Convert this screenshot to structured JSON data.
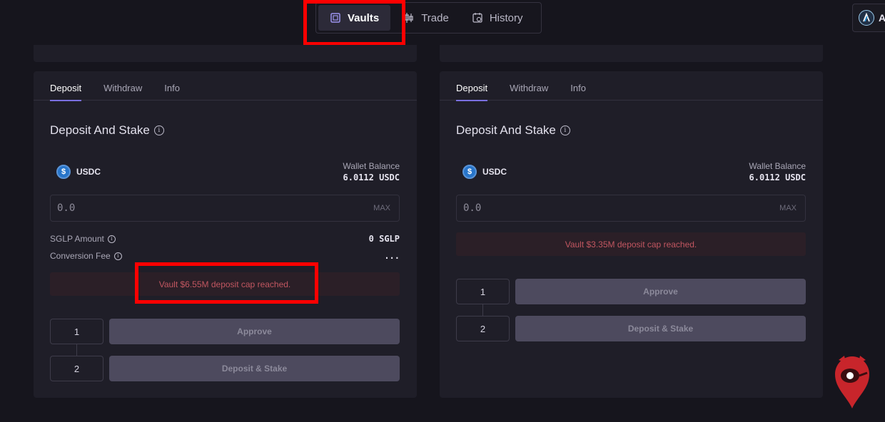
{
  "nav": {
    "tabs": [
      {
        "label": "Vaults",
        "icon": "vault-icon",
        "active": true
      },
      {
        "label": "Trade",
        "icon": "candlestick-icon",
        "active": false
      },
      {
        "label": "History",
        "icon": "history-icon",
        "active": false
      }
    ]
  },
  "wallet": {
    "label": "A",
    "icon": "arbitrum-icon"
  },
  "panels": [
    {
      "tabs": [
        "Deposit",
        "Withdraw",
        "Info"
      ],
      "title": "Deposit And Stake",
      "token": "USDC",
      "wallet_balance_label": "Wallet Balance",
      "wallet_balance_value": "6.0112 USDC",
      "amount_placeholder": "0.0",
      "max_label": "MAX",
      "sglp_label": "SGLP Amount",
      "sglp_value": "0 SGLP",
      "fee_label": "Conversion Fee",
      "fee_value": "...",
      "error": "Vault $6.55M deposit cap reached.",
      "step1": "1",
      "step2": "2",
      "approve_label": "Approve",
      "deposit_label": "Deposit & Stake"
    },
    {
      "tabs": [
        "Deposit",
        "Withdraw",
        "Info"
      ],
      "title": "Deposit And Stake",
      "token": "USDC",
      "wallet_balance_label": "Wallet Balance",
      "wallet_balance_value": "6.0112 USDC",
      "amount_placeholder": "0.0",
      "max_label": "MAX",
      "error": "Vault $3.35M deposit cap reached.",
      "step1": "1",
      "step2": "2",
      "approve_label": "Approve",
      "deposit_label": "Deposit & Stake"
    }
  ],
  "colors": {
    "background": "#16151d",
    "panel": "#1f1e28",
    "accent": "#7a6fe0",
    "error_text": "#c15660",
    "highlight": "#ff0000"
  }
}
